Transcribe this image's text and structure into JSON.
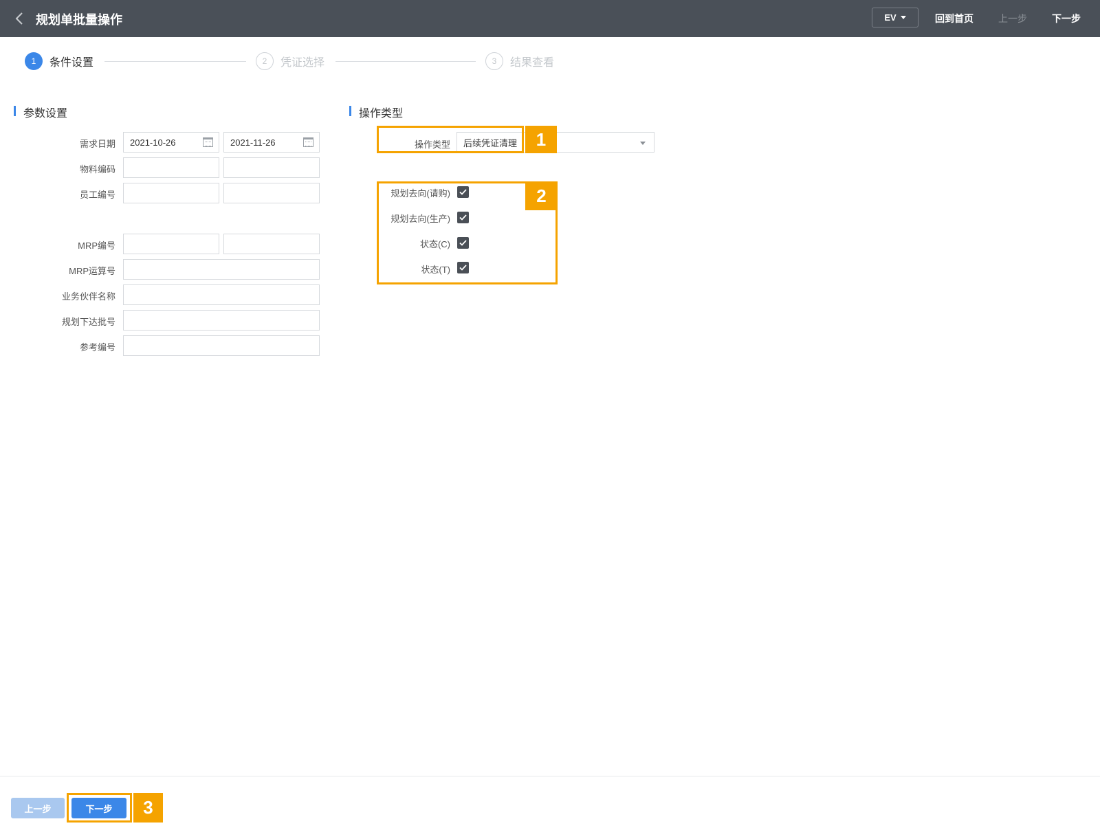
{
  "header": {
    "title": "规划单批量操作",
    "env": "EV",
    "home_label": "回到首页",
    "prev_label": "上一步",
    "next_label": "下一步"
  },
  "steps": [
    {
      "num": "1",
      "label": "条件设置",
      "state": "active"
    },
    {
      "num": "2",
      "label": "凭证选择",
      "state": "inactive"
    },
    {
      "num": "3",
      "label": "结果查看",
      "state": "inactive"
    }
  ],
  "params": {
    "title": "参数设置",
    "demand_date_label": "需求日期",
    "demand_date_from": "2021-10-26",
    "demand_date_to": "2021-11-26",
    "material_code_label": "物料编码",
    "employee_no_label": "员工编号",
    "mrp_no_label": "MRP编号",
    "mrp_calc_no_label": "MRP运算号",
    "partner_name_label": "业务伙伴名称",
    "plan_batch_no_label": "规划下达批号",
    "reference_no_label": "参考编号"
  },
  "operation": {
    "title": "操作类型",
    "type_label": "操作类型",
    "type_value": "后续凭证清理",
    "checkboxes": [
      {
        "label": "规划去向(请购)",
        "checked": true
      },
      {
        "label": "规划去向(生产)",
        "checked": true
      },
      {
        "label": "状态(C)",
        "checked": true
      },
      {
        "label": "状态(T)",
        "checked": true
      }
    ]
  },
  "annotations": [
    "1",
    "2",
    "3"
  ],
  "footer": {
    "prev_label": "上一步",
    "next_label": "下一步"
  },
  "colors": {
    "header_bg": "#4a5058",
    "accent": "#3b87e8",
    "annotation": "#f5a300",
    "disabled_button": "#a9c8ef"
  }
}
